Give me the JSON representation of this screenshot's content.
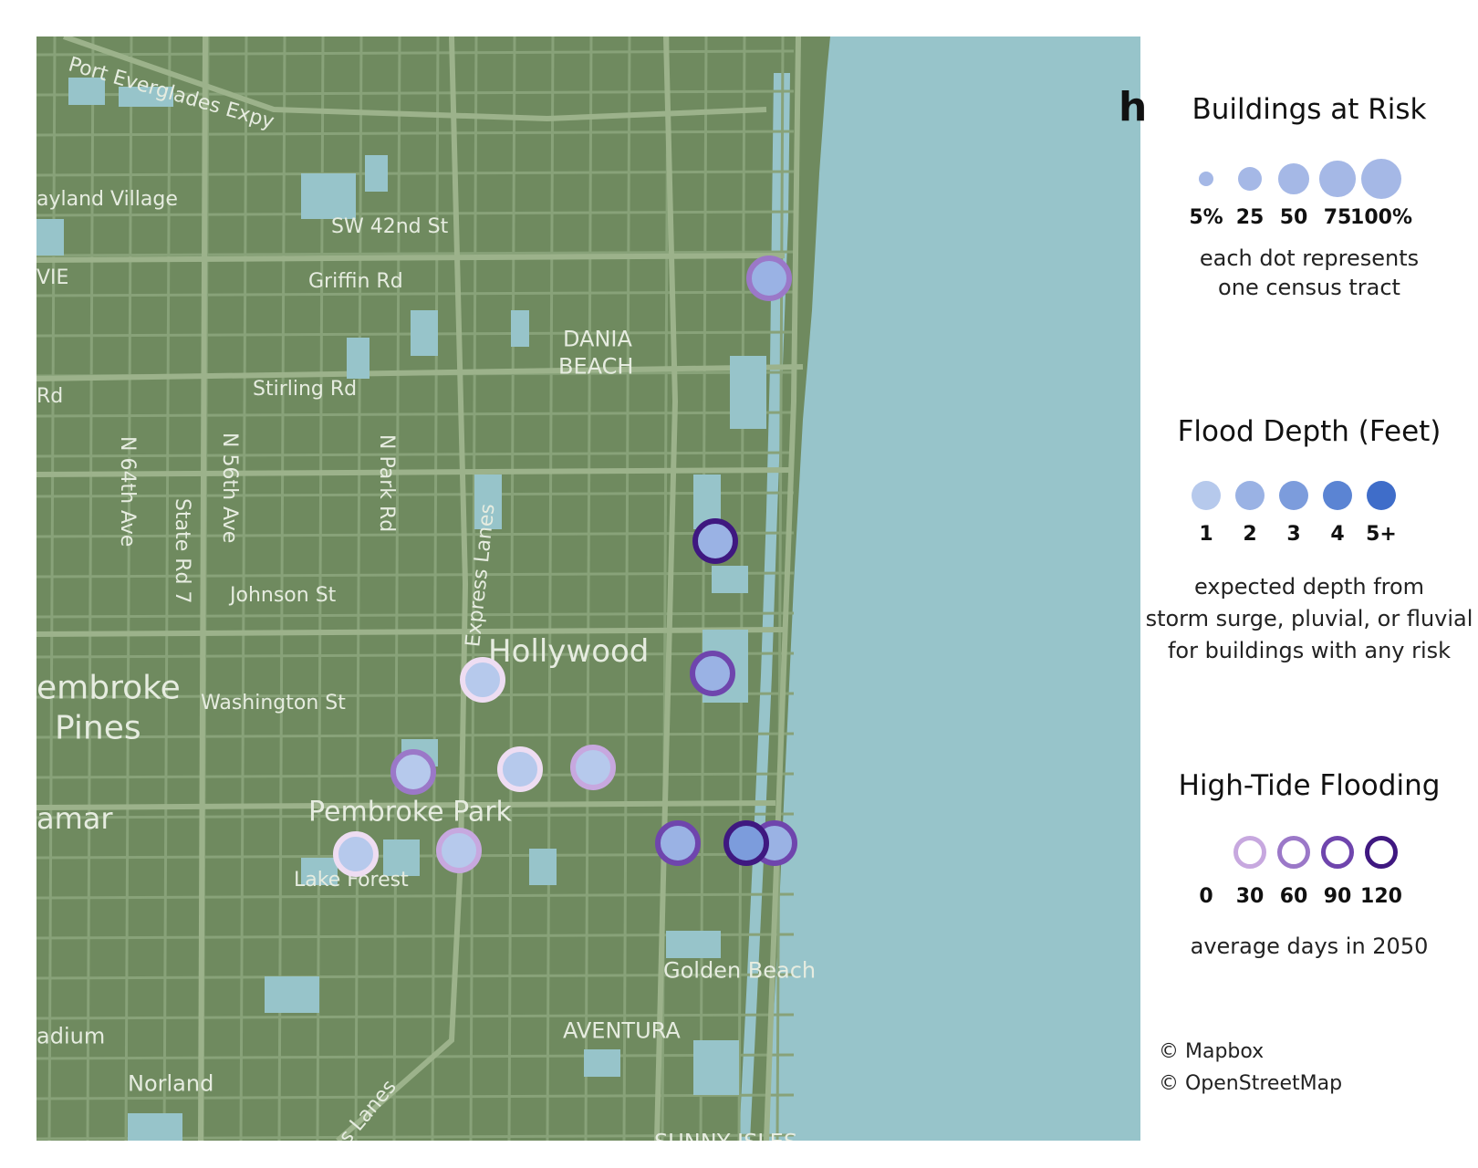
{
  "map": {
    "colors": {
      "land": "#6f8a5f",
      "water": "#97c4ca",
      "road": "#88a279",
      "road_major": "#9cb28b"
    },
    "labels": [
      {
        "id": "port-everglades-expy",
        "text": "Port Everglades Expy",
        "size": 22,
        "rotate": 16
      },
      {
        "id": "wayland-village",
        "text": "ayland Village",
        "size": 22,
        "rotate": 0
      },
      {
        "id": "sw-42nd-st",
        "text": "SW 42nd St",
        "size": 22,
        "rotate": 0
      },
      {
        "id": "vie",
        "text": "VIE",
        "size": 22,
        "rotate": 0
      },
      {
        "id": "griffin-rd",
        "text": "Griffin Rd",
        "size": 22,
        "rotate": 0
      },
      {
        "id": "dania",
        "text": "DANIA",
        "size": 24,
        "rotate": 0
      },
      {
        "id": "beach",
        "text": "BEACH",
        "size": 24,
        "rotate": 0
      },
      {
        "id": "rd-left",
        "text": "Rd",
        "size": 22,
        "rotate": 0
      },
      {
        "id": "stirling-rd",
        "text": "Stirling Rd",
        "size": 22,
        "rotate": 0
      },
      {
        "id": "n-64th-ave",
        "text": "N 64th Ave",
        "size": 22,
        "rotate": 90
      },
      {
        "id": "state-rd-7",
        "text": "State Rd 7",
        "size": 22,
        "rotate": 90
      },
      {
        "id": "n-56th-ave",
        "text": "N 56th Ave",
        "size": 22,
        "rotate": 90
      },
      {
        "id": "n-park-rd",
        "text": "N Park Rd",
        "size": 22,
        "rotate": 90
      },
      {
        "id": "express-lanes",
        "text": "Express Lanes",
        "size": 22,
        "rotate": -84
      },
      {
        "id": "johnson-st",
        "text": "Johnson St",
        "size": 22,
        "rotate": 0
      },
      {
        "id": "hollywood",
        "text": "Hollywood",
        "size": 34,
        "rotate": 0
      },
      {
        "id": "pembroke",
        "text": "embroke",
        "size": 36,
        "rotate": 0
      },
      {
        "id": "pines",
        "text": "Pines",
        "size": 36,
        "rotate": 0
      },
      {
        "id": "washington-st",
        "text": "Washington St",
        "size": 22,
        "rotate": 0
      },
      {
        "id": "amar",
        "text": "amar",
        "size": 32,
        "rotate": 0
      },
      {
        "id": "pembroke-park",
        "text": "Pembroke Park",
        "size": 30,
        "rotate": 0
      },
      {
        "id": "lake-forest",
        "text": "Lake Forest",
        "size": 22,
        "rotate": 0
      },
      {
        "id": "golden-beach",
        "text": "Golden Beach",
        "size": 24,
        "rotate": 0
      },
      {
        "id": "adium",
        "text": "adium",
        "size": 24,
        "rotate": 0
      },
      {
        "id": "aventura",
        "text": "AVENTURA",
        "size": 24,
        "rotate": 0
      },
      {
        "id": "norland",
        "text": "Norland",
        "size": 24,
        "rotate": 0
      },
      {
        "id": "lanes-bottom",
        "text": "s Lanes",
        "size": 22,
        "rotate": -50
      },
      {
        "id": "sunny-isles",
        "text": "SUNNY ISLES",
        "size": 24,
        "rotate": 0
      }
    ],
    "tracts": [
      {
        "id": "tract-1",
        "buildings_pct": 50,
        "depth_ft": 2,
        "hightide_days": 60
      },
      {
        "id": "tract-2",
        "buildings_pct": 50,
        "depth_ft": 2,
        "hightide_days": 120
      },
      {
        "id": "tract-3",
        "buildings_pct": 50,
        "depth_ft": 2,
        "hightide_days": 90
      },
      {
        "id": "tract-4",
        "buildings_pct": 50,
        "depth_ft": 1,
        "hightide_days": 0
      },
      {
        "id": "tract-5",
        "buildings_pct": 50,
        "depth_ft": 1,
        "hightide_days": 60
      },
      {
        "id": "tract-6",
        "buildings_pct": 50,
        "depth_ft": 1,
        "hightide_days": 0
      },
      {
        "id": "tract-7",
        "buildings_pct": 50,
        "depth_ft": 1,
        "hightide_days": 30
      },
      {
        "id": "tract-8",
        "buildings_pct": 50,
        "depth_ft": 1,
        "hightide_days": 0
      },
      {
        "id": "tract-9",
        "buildings_pct": 50,
        "depth_ft": 1,
        "hightide_days": 30
      },
      {
        "id": "tract-10",
        "buildings_pct": 50,
        "depth_ft": 2,
        "hightide_days": 90
      },
      {
        "id": "tract-11",
        "buildings_pct": 50,
        "depth_ft": 2,
        "hightide_days": 90
      },
      {
        "id": "tract-12",
        "buildings_pct": 50,
        "depth_ft": 3,
        "hightide_days": 120
      }
    ]
  },
  "legend": {
    "cutoff_title": "h",
    "buildings": {
      "title": "Buildings at Risk",
      "items": [
        {
          "label": "5%",
          "pct": 5
        },
        {
          "label": "25",
          "pct": 25
        },
        {
          "label": "50",
          "pct": 50
        },
        {
          "label": "75",
          "pct": 75
        },
        {
          "label": "100%",
          "pct": 100
        }
      ],
      "color": "#a5b8e6",
      "note_line1": "each dot represents",
      "note_line2": "one census tract"
    },
    "depth": {
      "title": "Flood Depth (Feet)",
      "items": [
        {
          "label": "1",
          "color": "#b6c9ec"
        },
        {
          "label": "2",
          "color": "#9ab2e4"
        },
        {
          "label": "3",
          "color": "#7c9cdc"
        },
        {
          "label": "4",
          "color": "#5b84d3"
        },
        {
          "label": "5+",
          "color": "#3f6dc9"
        }
      ],
      "note_line1": "expected depth from",
      "note_line2": "storm surge, pluvial, or fluvial",
      "note_line3": "for buildings with any risk"
    },
    "hightide": {
      "title": "High-Tide Flooding",
      "items": [
        {
          "label": "0",
          "color": "#eeddf2"
        },
        {
          "label": "30",
          "color": "#c7a8df"
        },
        {
          "label": "60",
          "color": "#9b78c8"
        },
        {
          "label": "90",
          "color": "#6f45ad"
        },
        {
          "label": "120",
          "color": "#3f1880"
        }
      ],
      "note": "average days in 2050"
    },
    "credits": {
      "mapbox": "© Mapbox",
      "osm": "© OpenStreetMap"
    }
  }
}
